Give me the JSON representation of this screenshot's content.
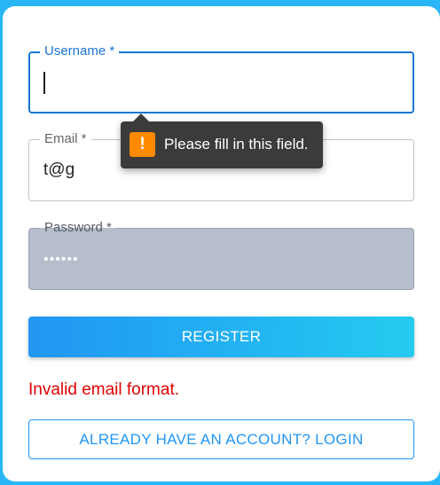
{
  "form": {
    "username": {
      "label": "Username *",
      "value": ""
    },
    "email": {
      "label": "Email *",
      "value": "t@g"
    },
    "password": {
      "label": "Password *",
      "value": "••••••"
    }
  },
  "tooltip": {
    "icon": "warning-icon",
    "text": "Please fill in this field.",
    "icon_glyph": "!"
  },
  "register_label": "REGISTER",
  "error_message": "Invalid email format.",
  "login_label": "ALREADY HAVE AN ACCOUNT? LOGIN",
  "colors": {
    "background": "#29b6f6",
    "accent": "#2196f3",
    "focus": "#1976d2",
    "error": "#e00000",
    "warning": "#ff8a00"
  }
}
